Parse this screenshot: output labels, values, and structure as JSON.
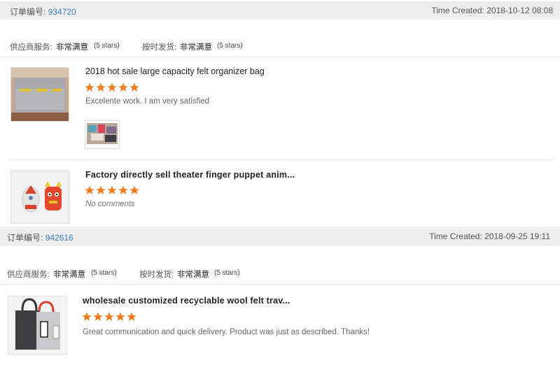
{
  "colors": {
    "star": "#f07c1c",
    "link": "#3a7fc1",
    "header_bg": "#eeeeee"
  },
  "orders": [
    {
      "order_label": "订单编号:",
      "order_number": "934720",
      "time_created": "Time Created: 2018-10-12 08:08",
      "supplier_label": "供应商服务:",
      "supplier_value": "非常满意",
      "supplier_stars": "(5 stars)",
      "shipping_label": "按时发货:",
      "shipping_value": "非常满意",
      "shipping_stars": "(5 stars)",
      "items": [
        {
          "title": "2018 hot sale large capacity felt organizer bag",
          "rating": 5,
          "comment": "Excelente work. I am very satisfied",
          "thumb_icon": "felt-organizer-bag",
          "photo_icon": "review-photo"
        },
        {
          "title": "Factory directly sell theater finger puppet anim...",
          "rating": 5,
          "comment": "No comments",
          "thumb_icon": "finger-puppet"
        }
      ]
    },
    {
      "order_label": "订单编号:",
      "order_number": "942616",
      "time_created": "Time Created: 2018-09-25 19:11",
      "supplier_label": "供应商服务:",
      "supplier_value": "非常满意",
      "supplier_stars": "(5 stars)",
      "shipping_label": "按时发货:",
      "shipping_value": "非常满意",
      "shipping_stars": "(5 stars)",
      "items": [
        {
          "title": "wholesale customized recyclable wool felt trav...",
          "rating": 5,
          "comment": "Great communication and quick delivery. Product was just as described. Thanks!",
          "thumb_icon": "felt-tote-bag"
        }
      ]
    }
  ]
}
